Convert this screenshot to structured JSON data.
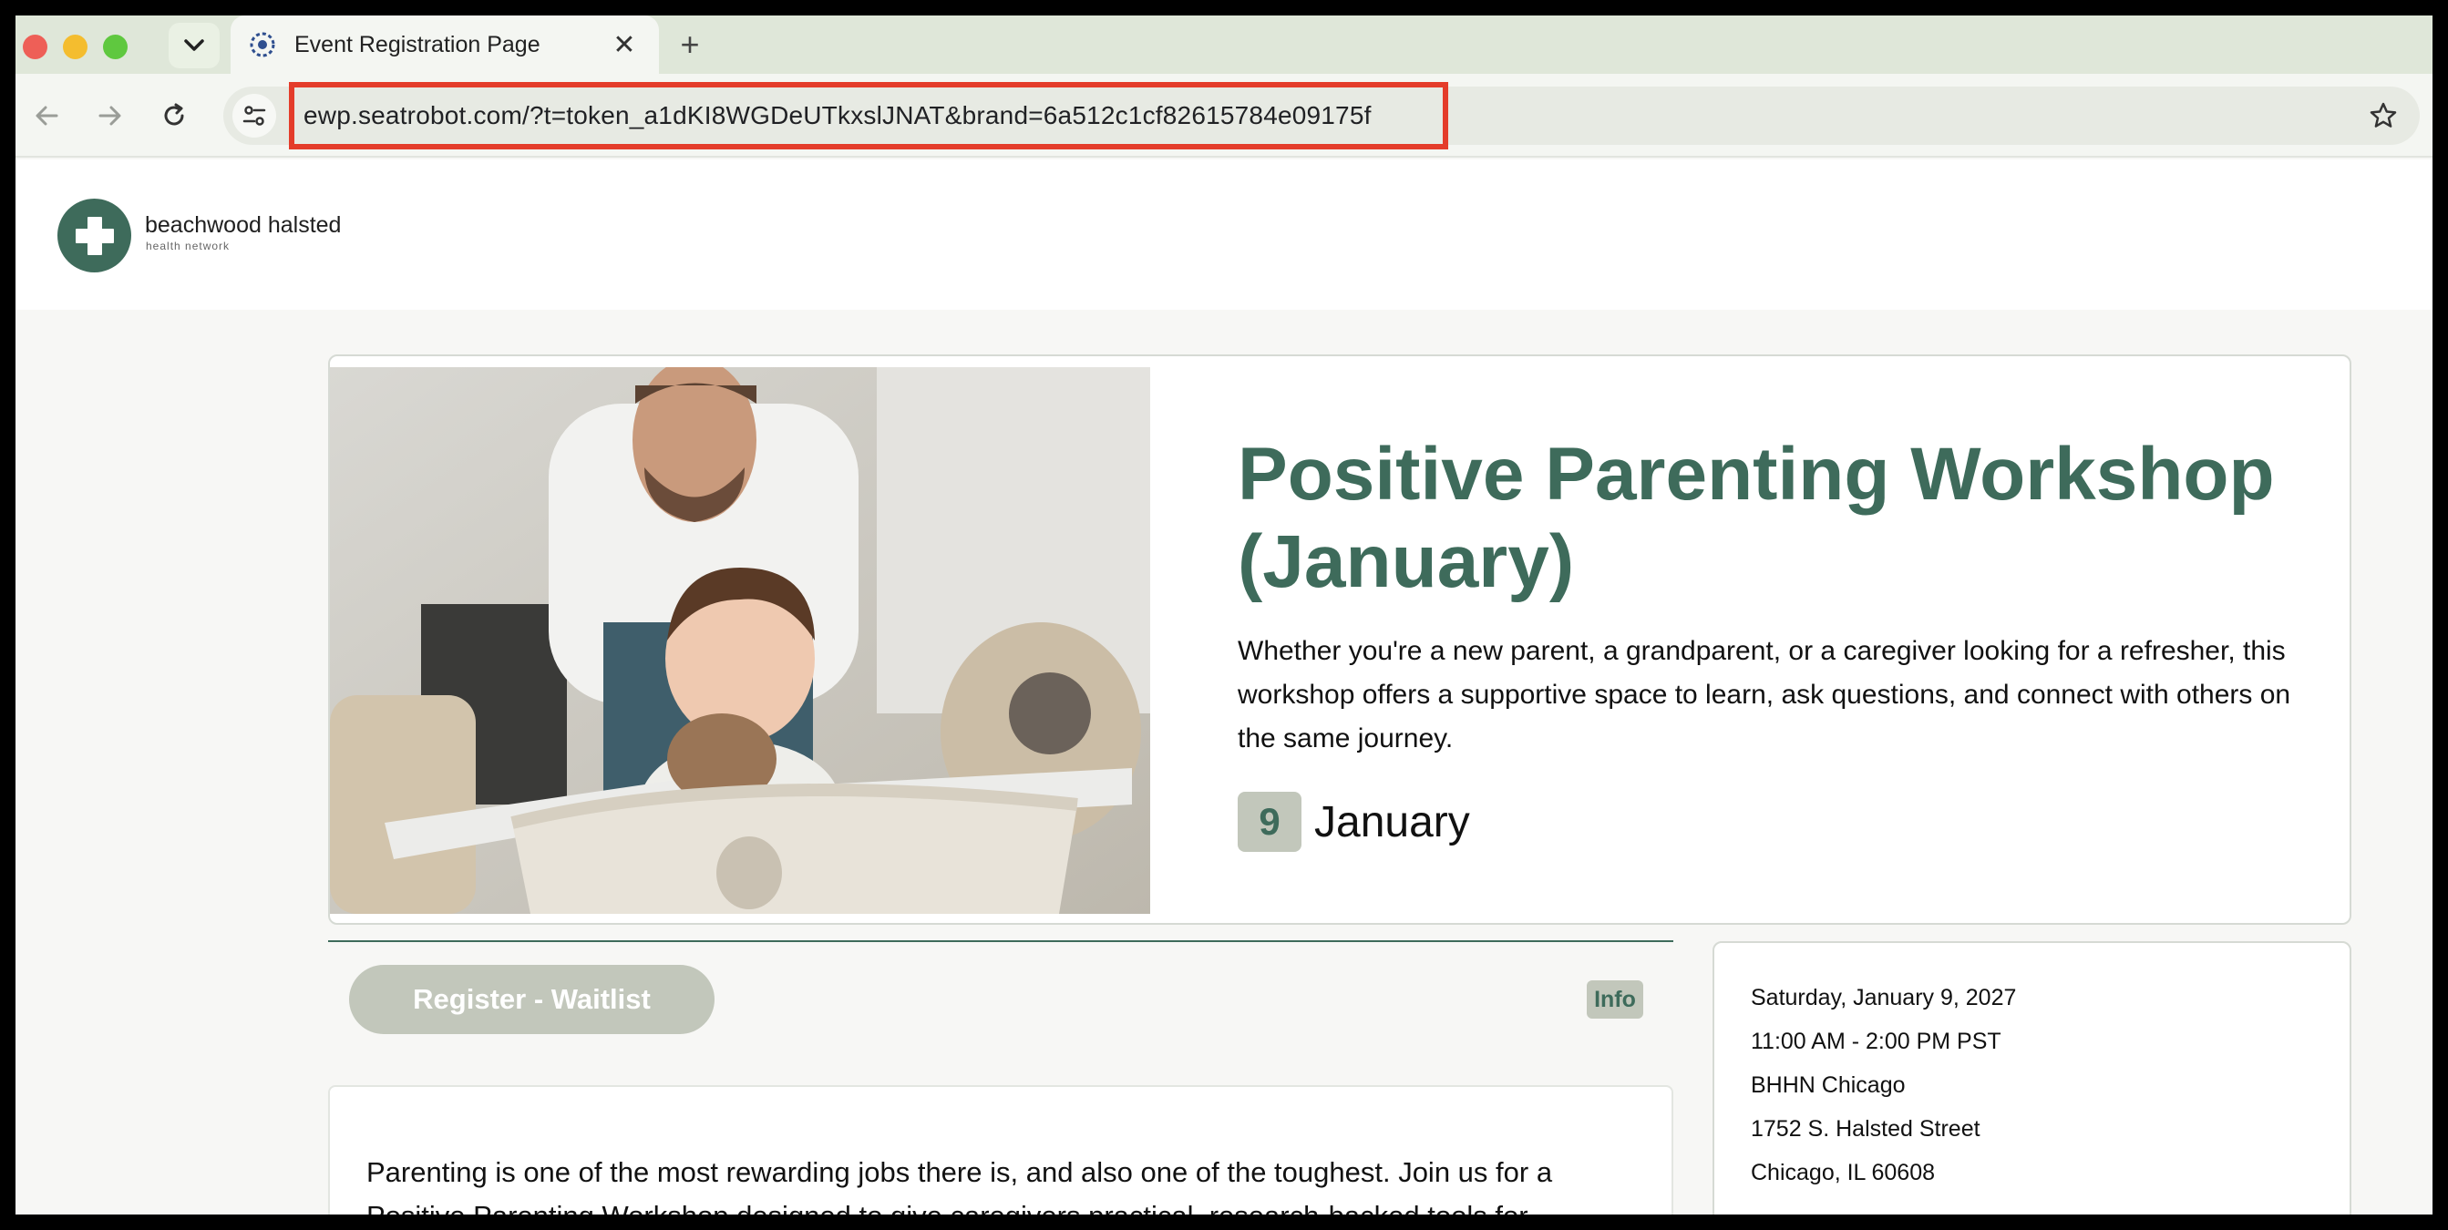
{
  "browser": {
    "tab_title": "Event Registration Page",
    "tab_close": "✕",
    "new_tab": "+",
    "url_host": "ewp.seatrobot.com",
    "url_rest": "/?t=token_a1dKI8WGDeUTkxslJNAT&brand=6a512c1cf82615784e09175f"
  },
  "site": {
    "logo_name": "beachwood halsted",
    "logo_sub": "health network"
  },
  "event": {
    "title": "Positive Parenting Workshop (January)",
    "description": "Whether you're a new parent, a grandparent, or a caregiver looking for a refresher, this workshop offers a supportive space to learn, ask questions, and connect with others on the same journey.",
    "day": "9",
    "month": "January"
  },
  "actions": {
    "register_label": "Register - Waitlist",
    "info_label": "Info"
  },
  "content": {
    "body": "Parenting is one of the most rewarding jobs there is, and also one of the toughest. Join us for a Positive Parenting Workshop designed to give caregivers practical, research-backed tools for"
  },
  "details": {
    "date": "Saturday, January 9, 2027",
    "time": "11:00 AM - 2:00 PM PST",
    "venue": "BHHN Chicago",
    "street": "1752 S. Halsted Street",
    "city": "Chicago, IL 60608"
  },
  "colors": {
    "brand_green": "#3e6b5b",
    "muted_button": "#c2c7bb",
    "url_highlight": "#e43c2a"
  }
}
